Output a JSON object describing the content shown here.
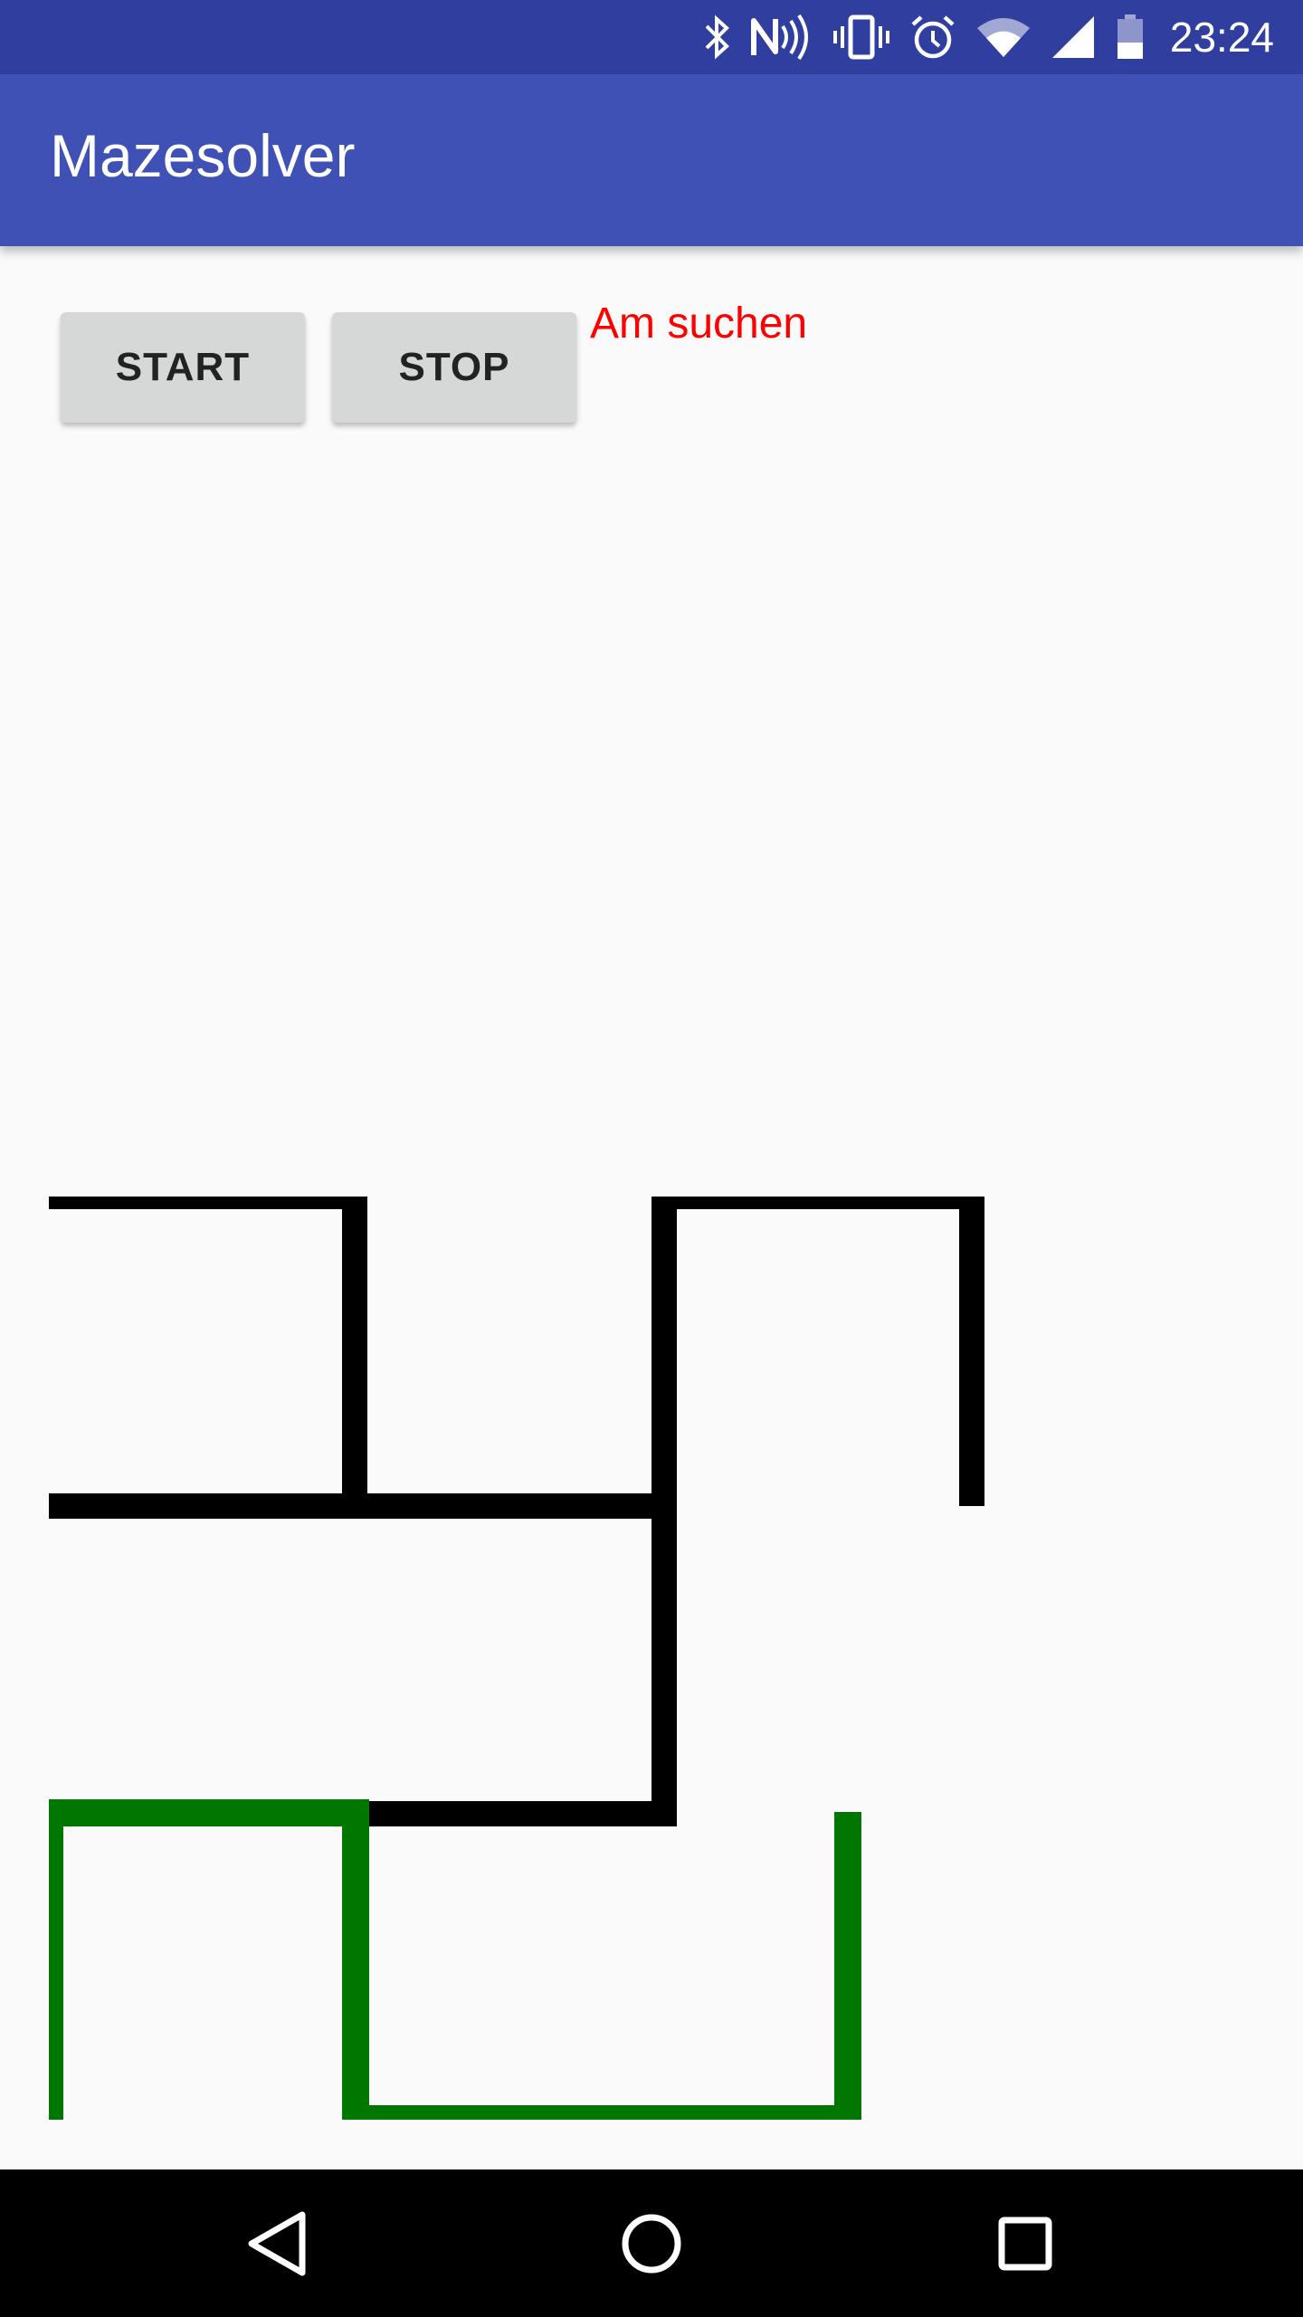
{
  "status_bar": {
    "time": "23:24",
    "icons": [
      "bluetooth-icon",
      "nfc-icon",
      "vibrate-icon",
      "alarm-icon",
      "wifi-icon",
      "cell-signal-icon",
      "battery-icon"
    ]
  },
  "app_bar": {
    "title": "Mazesolver"
  },
  "controls": {
    "start_label": "START",
    "stop_label": "STOP",
    "status": "Am suchen"
  },
  "maze": {
    "wall_color": "#000000",
    "path_color": "#007700"
  },
  "nav_bar": {
    "icons": [
      "back-icon",
      "home-icon",
      "recents-icon"
    ]
  },
  "colors": {
    "status_bar": "#303f9f",
    "app_bar": "#3f51b5",
    "status_text": "#ff0000",
    "button": "#d6d7d7"
  }
}
